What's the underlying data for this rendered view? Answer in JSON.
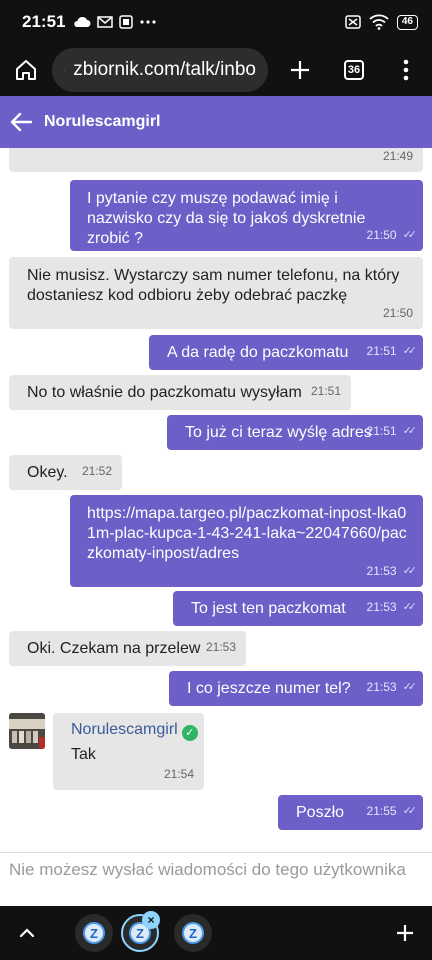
{
  "status_bar": {
    "time": "21:51",
    "battery": "46",
    "icons": [
      "cloud-icon",
      "gmail-icon",
      "news-icon",
      "more-dots-icon",
      "silent-icon",
      "wifi-icon",
      "battery-icon"
    ]
  },
  "browser": {
    "url": "zbiornik.com/talk/inbo",
    "tab_count": "36",
    "icons": [
      "home-icon",
      "site-info-icon",
      "new-tab-icon",
      "tab-switcher-icon",
      "overflow-menu-icon"
    ]
  },
  "chat": {
    "contact_name": "Norulescamgirl",
    "messages": [
      {
        "dir": "in",
        "text": "",
        "time": "21:49"
      },
      {
        "dir": "out",
        "text": "I pytanie czy muszę podawać imię i nazwisko czy da się to jakoś dyskretnie zrobić ?",
        "time": "21:50"
      },
      {
        "dir": "in",
        "text": "Nie musisz. Wystarczy sam numer telefonu, na który dostaniesz kod odbioru żeby odebrać paczkę",
        "time": "21:50"
      },
      {
        "dir": "out",
        "text": "A da radę do paczkomatu",
        "time": "21:51"
      },
      {
        "dir": "in",
        "text": "No to właśnie do paczkomatu wysyłam",
        "time": "21:51"
      },
      {
        "dir": "out",
        "text": "To już ci teraz wyślę adres",
        "time": "21:51"
      },
      {
        "dir": "in",
        "text": "Okey.",
        "time": "21:52"
      },
      {
        "dir": "out",
        "text": "https://mapa.targeo.pl/paczkomat-inpost-lka01m-plac-kupca-1-43-241-laka~22047660/paczkomaty-inpost/adres",
        "time": "21:53"
      },
      {
        "dir": "out",
        "text": "To jest ten paczkomat",
        "time": "21:53"
      },
      {
        "dir": "in",
        "text": "Oki. Czekam na przelew",
        "time": "21:53"
      },
      {
        "dir": "out",
        "text": "I co jeszcze numer tel?",
        "time": "21:53"
      },
      {
        "dir": "in",
        "sender": "Norulescamgirl",
        "text": "Tak",
        "time": "21:54"
      },
      {
        "dir": "out",
        "text": "Poszło",
        "time": "21:55"
      }
    ]
  },
  "footer": {
    "no_reply_notice": "Nie możesz wysłać wiadomości do tego użytkownika"
  },
  "bottom_nav": {
    "tab_letter": "Z",
    "close_glyph": "×"
  },
  "colors": {
    "accent": "#6c5fc7",
    "incoming_bubble": "#e6e6e6",
    "system_bar": "#111111",
    "verified": "#2fb463"
  }
}
